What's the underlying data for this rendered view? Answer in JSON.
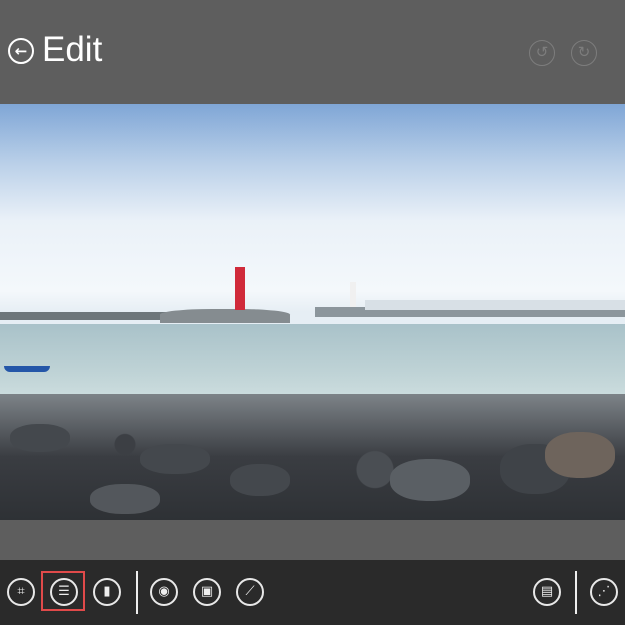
{
  "header": {
    "title": "Edit",
    "back_icon": "back-arrow-icon",
    "undo_icon": "undo-icon",
    "redo_icon": "redo-icon"
  },
  "toolbar": {
    "left": [
      {
        "name": "crop",
        "icon": "⌗"
      },
      {
        "name": "adjust",
        "icon": "☰",
        "selected": true
      },
      {
        "name": "paint-roller",
        "icon": "▮"
      },
      {
        "name": "red-eye",
        "icon": "◉"
      },
      {
        "name": "image-effects",
        "icon": "▣"
      },
      {
        "name": "retouch",
        "icon": "⟋"
      }
    ],
    "right": [
      {
        "name": "gallery",
        "icon": "▤"
      },
      {
        "name": "share",
        "icon": "⋰"
      }
    ],
    "selected_color": "#e04a4a"
  }
}
